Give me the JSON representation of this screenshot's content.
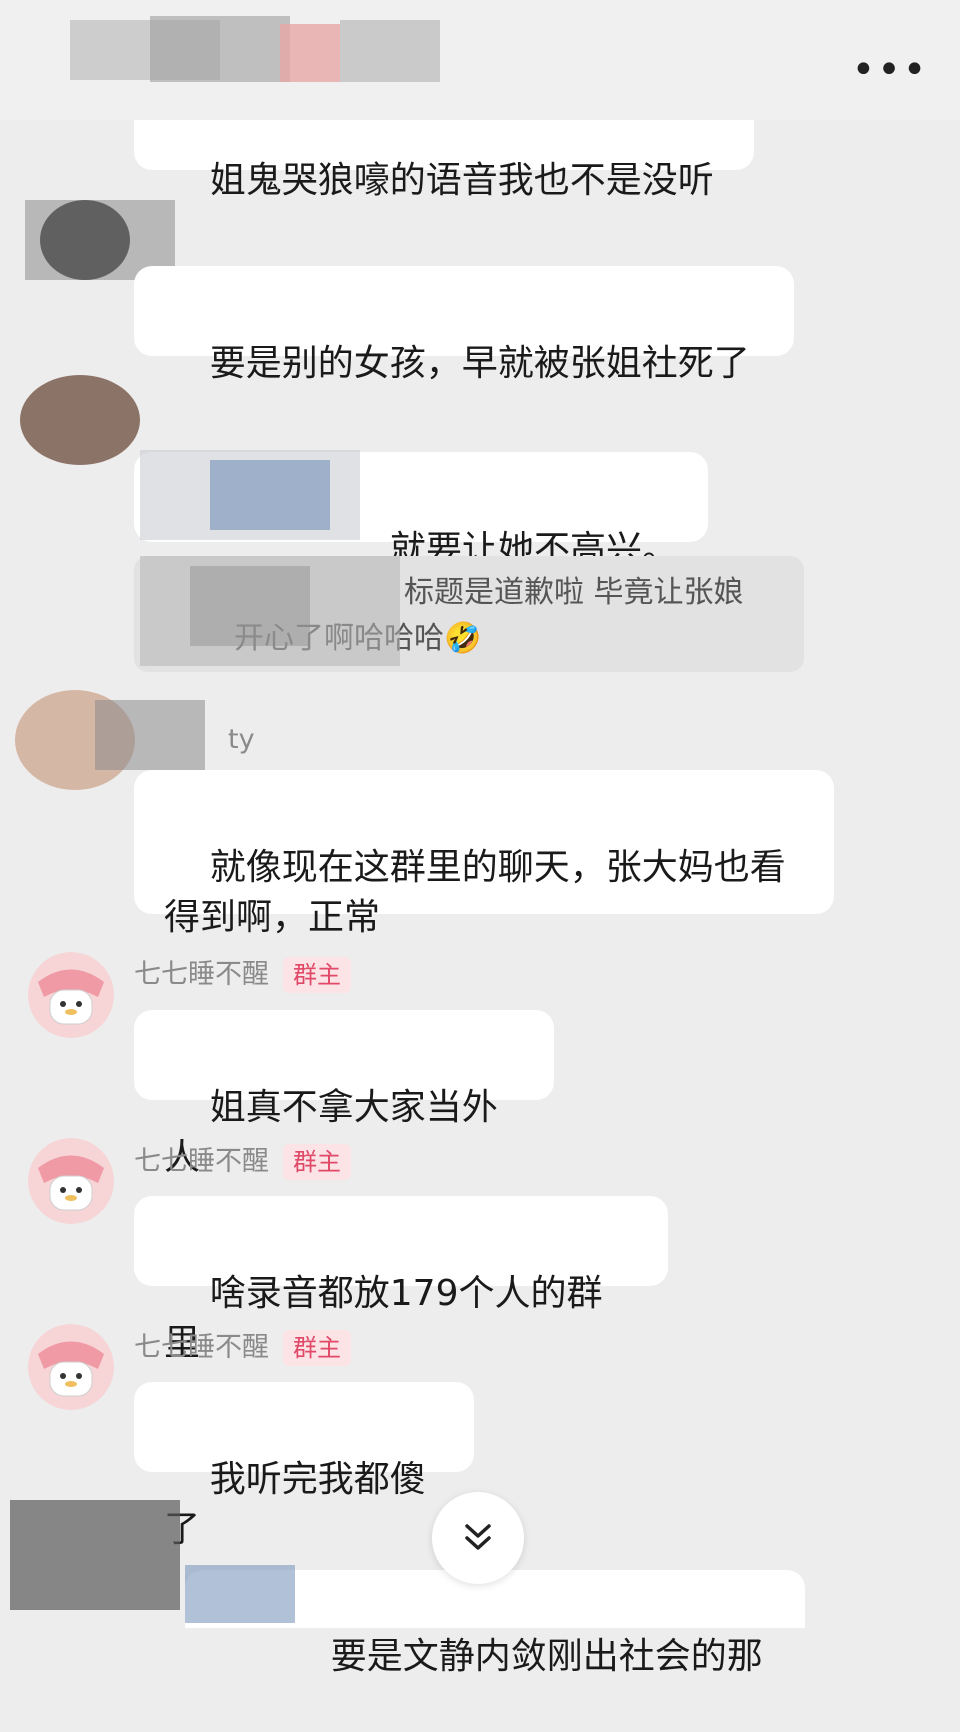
{
  "header": {
    "more_label": "•••"
  },
  "messages": [
    {
      "id": "m1",
      "text": "姐鬼哭狼嚎的语音我也不是没听",
      "partial": true
    },
    {
      "id": "m2",
      "text": "要是别的女孩，早就被张姐社死了"
    },
    {
      "id": "m3",
      "text": "就要让她不高兴。",
      "partially_redacted": true
    },
    {
      "id": "m3q",
      "quote_line1": "标题是道歉啦 毕竟让张娘",
      "quote_line2": "开心了啊哈哈哈",
      "emoji": "🤣"
    },
    {
      "id": "m4",
      "sender_fragment": "ty",
      "text": "就像现在这群里的聊天，张大妈也看\n得到啊，正常"
    },
    {
      "id": "m5",
      "sender": "七七睡不醒",
      "badge": "群主",
      "text": "姐真不拿大家当外人"
    },
    {
      "id": "m6",
      "sender": "七七睡不醒",
      "badge": "群主",
      "text": "啥录音都放179个人的群里"
    },
    {
      "id": "m7",
      "sender": "七七睡不醒",
      "badge": "群主",
      "text": "我听完我都傻了"
    },
    {
      "id": "m8",
      "text": "要是文静内敛刚出社会的那",
      "partial": true
    }
  ],
  "colors": {
    "background": "#ededed",
    "bubble": "#ffffff",
    "quote": "#e2e2e2",
    "badge_bg": "#fbe3e6",
    "badge_text": "#e04a68"
  },
  "icons": {
    "more": "more-dots-icon",
    "scroll": "chevron-double-down-icon",
    "avatar": "melody-avatar-icon"
  }
}
